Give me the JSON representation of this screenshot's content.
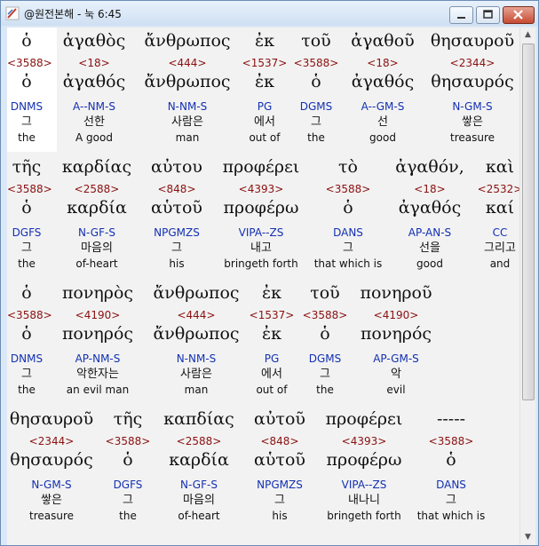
{
  "window": {
    "title": "@원전본해 - 눅 6:45"
  },
  "verses": [
    {
      "words": [
        {
          "greek": "ὁ",
          "strong": "<3588>",
          "lemma": "ὁ",
          "parse": "DNMS",
          "korean": "그",
          "english": "the"
        },
        {
          "greek": "ἀγαθὸς",
          "strong": "<18>",
          "lemma": "ἀγαθός",
          "parse": "A--NM-S",
          "korean": "선한",
          "english": "A good"
        },
        {
          "greek": "ἄνθρωπος",
          "strong": "<444>",
          "lemma": "ἄνθρωπος",
          "parse": "N-NM-S",
          "korean": "사람은",
          "english": "man"
        },
        {
          "greek": "ἐκ",
          "strong": "<1537>",
          "lemma": "ἐκ",
          "parse": "PG",
          "korean": "에서",
          "english": "out of"
        },
        {
          "greek": "τοῦ",
          "strong": "<3588>",
          "lemma": "ὁ",
          "parse": "DGMS",
          "korean": "그",
          "english": "the"
        },
        {
          "greek": "ἀγαθοῦ",
          "strong": "<18>",
          "lemma": "ἀγαθός",
          "parse": "A--GM-S",
          "korean": "선",
          "english": "good"
        },
        {
          "greek": "θησαυροῦ",
          "strong": "<2344>",
          "lemma": "θησαυρός",
          "parse": "N-GM-S",
          "korean": "쌓은",
          "english": "treasure"
        }
      ]
    },
    {
      "words": [
        {
          "greek": "τῆς",
          "strong": "<3588>",
          "lemma": "ὁ",
          "parse": "DGFS",
          "korean": "그",
          "english": "the"
        },
        {
          "greek": "καρδίας",
          "strong": "<2588>",
          "lemma": "καρδία",
          "parse": "N-GF-S",
          "korean": "마음의",
          "english": "of-heart"
        },
        {
          "greek": "αὐτου",
          "strong": "<848>",
          "lemma": "αὑτοῦ",
          "parse": "NPGMZS",
          "korean": "그",
          "english": "his"
        },
        {
          "greek": "προφέρει",
          "strong": "<4393>",
          "lemma": "προφέρω",
          "parse": "VIPA--ZS",
          "korean": "내고",
          "english": "bringeth forth"
        },
        {
          "greek": "τὸ",
          "strong": "<3588>",
          "lemma": "ὁ",
          "parse": "DANS",
          "korean": "그",
          "english": "that which is"
        },
        {
          "greek": "ἀγαθόν,",
          "strong": "<18>",
          "lemma": "ἀγαθός",
          "parse": "AP-AN-S",
          "korean": "선을",
          "english": "good"
        },
        {
          "greek": "καὶ",
          "strong": "<2532>",
          "lemma": "καί",
          "parse": "CC",
          "korean": "그리고",
          "english": "and"
        }
      ]
    },
    {
      "words": [
        {
          "greek": "ὁ",
          "strong": "<3588>",
          "lemma": "ὁ",
          "parse": "DNMS",
          "korean": "그",
          "english": "the"
        },
        {
          "greek": "πονηρὸς",
          "strong": "<4190>",
          "lemma": "πονηρός",
          "parse": "AP-NM-S",
          "korean": "악한자는",
          "english": "an evil man"
        },
        {
          "greek": "ἄνθρωπος",
          "strong": "<444>",
          "lemma": "ἄνθρωπος",
          "parse": "N-NM-S",
          "korean": "사람은",
          "english": "man"
        },
        {
          "greek": "ἐκ",
          "strong": "<1537>",
          "lemma": "ἐκ",
          "parse": "PG",
          "korean": "에서",
          "english": "out of"
        },
        {
          "greek": "τοῦ",
          "strong": "<3588>",
          "lemma": "ὁ",
          "parse": "DGMS",
          "korean": "그",
          "english": "the"
        },
        {
          "greek": "πονηροῦ",
          "strong": "<4190>",
          "lemma": "πονηρός",
          "parse": "AP-GM-S",
          "korean": "악",
          "english": "evil"
        }
      ]
    },
    {
      "words": [
        {
          "greek": "θησαυροῦ",
          "strong": "<2344>",
          "lemma": "θησαυρός",
          "parse": "N-GM-S",
          "korean": "쌓은",
          "english": "treasure"
        },
        {
          "greek": "τῆς",
          "strong": "<3588>",
          "lemma": "ὁ",
          "parse": "DGFS",
          "korean": "그",
          "english": "the"
        },
        {
          "greek": "καπδίας",
          "strong": "<2588>",
          "lemma": "καρδία",
          "parse": "N-GF-S",
          "korean": "마음의",
          "english": "of-heart"
        },
        {
          "greek": "αὐτοῦ",
          "strong": "<848>",
          "lemma": "αὑτοῦ",
          "parse": "NPGMZS",
          "korean": "그",
          "english": "his"
        },
        {
          "greek": "προφέρει",
          "strong": "<4393>",
          "lemma": "προφέρω",
          "parse": "VIPA--ZS",
          "korean": "내나니",
          "english": "bringeth forth"
        },
        {
          "greek": "-----",
          "strong": "<3588>",
          "lemma": "ὁ",
          "parse": "DANS",
          "korean": "그",
          "english": "that which is"
        }
      ]
    }
  ]
}
